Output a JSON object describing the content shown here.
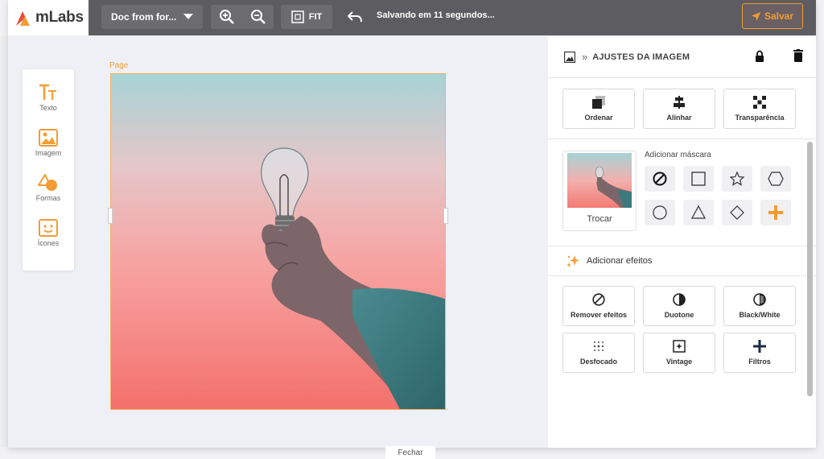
{
  "app": {
    "logo_text": "mLabs",
    "brand_colors": {
      "orange": "#f39c33",
      "red": "#e74c3c",
      "dark_bar": "#5d5d61"
    }
  },
  "topbar": {
    "doc_name": "Doc from for...",
    "fit_label": "FIT",
    "save_status": "Salvando em 11 segundos...",
    "save_label": "Salvar"
  },
  "tools": [
    {
      "label": "Texto",
      "icon": "text-icon"
    },
    {
      "label": "Imagem",
      "icon": "image-icon"
    },
    {
      "label": "Formas",
      "icon": "shapes-icon"
    },
    {
      "label": "Ícones",
      "icon": "icons-icon"
    }
  ],
  "canvas": {
    "page_label": "Page",
    "image_subject": "hand holding light bulb against pastel sky"
  },
  "panel": {
    "title": "AJUSTES DA IMAGEM",
    "actions": [
      {
        "label": "Ordenar",
        "icon": "order-icon"
      },
      {
        "label": "Alinhar",
        "icon": "align-icon"
      },
      {
        "label": "Transparência",
        "icon": "transparency-icon"
      }
    ],
    "swap_label": "Trocar",
    "mask_title": "Adicionar máscara",
    "masks": [
      "none",
      "square",
      "star",
      "hexagon",
      "circle",
      "triangle",
      "diamond",
      "plus"
    ],
    "effects_title": "Adicionar efeitos",
    "effects": [
      {
        "label": "Remover efeitos",
        "icon": "remove-effects-icon"
      },
      {
        "label": "Duotone",
        "icon": "duotone-icon"
      },
      {
        "label": "Black/White",
        "icon": "black-white-icon"
      },
      {
        "label": "Desfocado",
        "icon": "blur-icon"
      },
      {
        "label": "Vintage",
        "icon": "vintage-icon"
      },
      {
        "label": "Filtros",
        "icon": "filters-icon"
      }
    ]
  },
  "footer": {
    "close_label": "Fechar"
  }
}
